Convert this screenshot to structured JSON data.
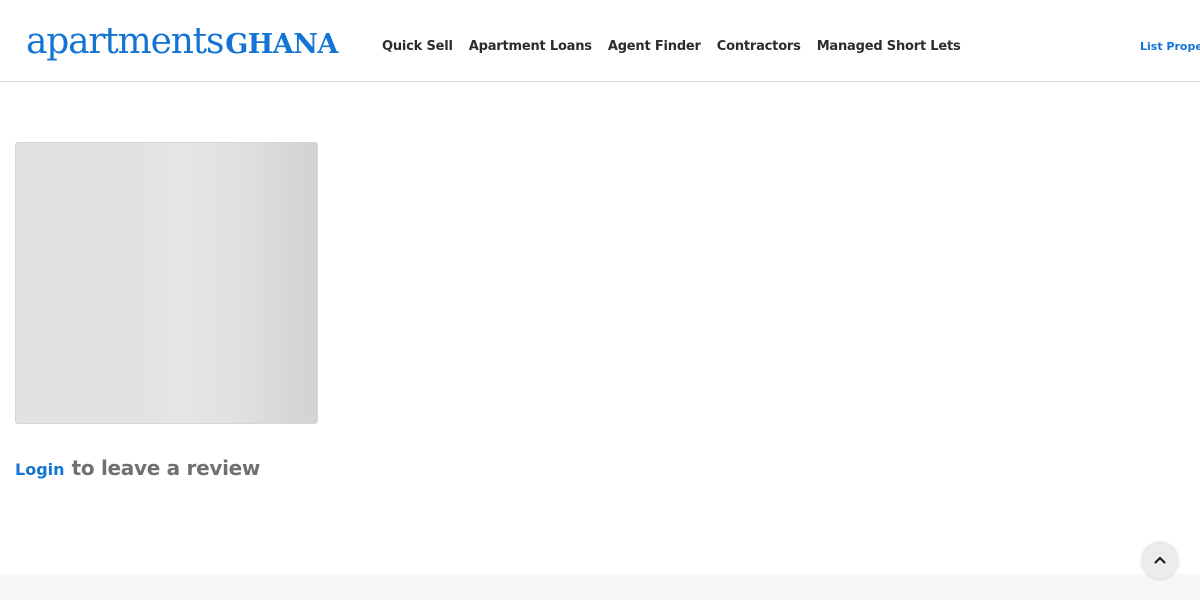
{
  "header": {
    "logo": {
      "light_text": "apartments",
      "bold_text": "GHANA"
    },
    "nav": [
      {
        "label": "Quick Sell"
      },
      {
        "label": "Apartment Loans"
      },
      {
        "label": "Agent Finder"
      },
      {
        "label": "Contractors"
      },
      {
        "label": "Managed Short Lets"
      }
    ],
    "list_property_label": "List Property"
  },
  "review": {
    "login_label": "Login",
    "prompt_text": "to leave a review"
  },
  "icons": {
    "back_to_top": "chevron-up-icon"
  },
  "colors": {
    "brand": "#1474d4",
    "nav_text": "#2c2c2c",
    "muted_text": "#707070"
  }
}
